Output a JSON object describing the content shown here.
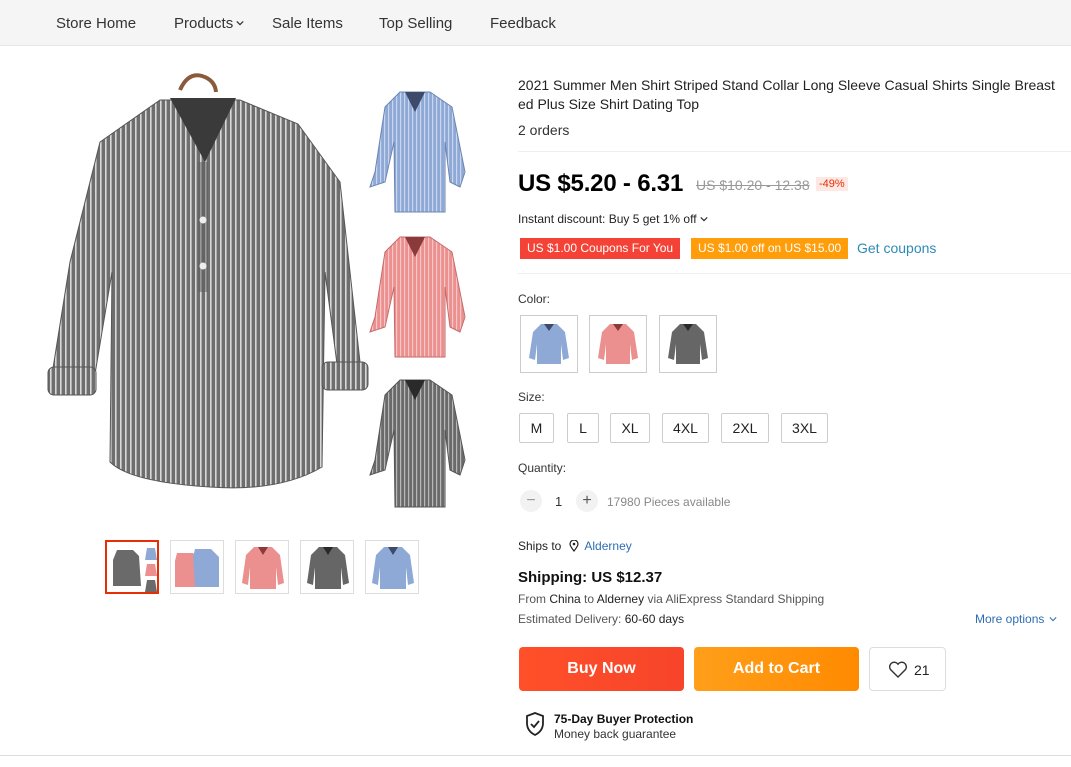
{
  "nav": {
    "items": [
      "Store Home",
      "Products",
      "Sale Items",
      "Top Selling",
      "Feedback"
    ]
  },
  "product": {
    "title": "2021 Summer Men Shirt Striped Stand Collar Long Sleeve Casual Shirts Single Breast ed Plus Size Shirt Dating Top",
    "orders": "2 orders",
    "price": "US $5.20 - 6.31",
    "old_price": "US $10.20 - 12.38",
    "discount": "-49%",
    "instant_discount": "Instant discount: Buy 5 get 1% off",
    "coupons": [
      "US $1.00 Coupons For You",
      "US $1.00 off on US $15.00"
    ],
    "get_coupons": "Get coupons"
  },
  "color": {
    "label": "Color:",
    "options": [
      "blue-shirt-swatch",
      "pink-shirt-swatch",
      "gray-shirt-swatch"
    ]
  },
  "size": {
    "label": "Size:",
    "options": [
      "M",
      "L",
      "XL",
      "4XL",
      "2XL",
      "3XL"
    ]
  },
  "quantity": {
    "label": "Quantity:",
    "value": "1",
    "available": "17980 Pieces available"
  },
  "shipping": {
    "ships_to_label": "Ships to",
    "ships_to": "Alderney",
    "cost": "Shipping: US $12.37",
    "from_prefix": "From",
    "from_country": "China",
    "to_word": "to",
    "to_country": "Alderney",
    "via": "via AliExpress Standard Shipping",
    "est_label": "Estimated Delivery:",
    "est_value": "60-60 days",
    "more_options": "More options"
  },
  "actions": {
    "buy_now": "Buy Now",
    "add_to_cart": "Add to Cart",
    "wishlist_count": "21"
  },
  "protection": {
    "title": "75-Day Buyer Protection",
    "subtitle": "Money back guarantee"
  },
  "colors": {
    "accent_red": "#e62e04",
    "coupon_red": "#f44336",
    "coupon_orange": "#ff9d0b",
    "link_blue": "#2e8ab8",
    "shirt_gray": "#6b6b6b",
    "shirt_blue": "#8fa9d6",
    "shirt_pink": "#ec8f8f"
  }
}
